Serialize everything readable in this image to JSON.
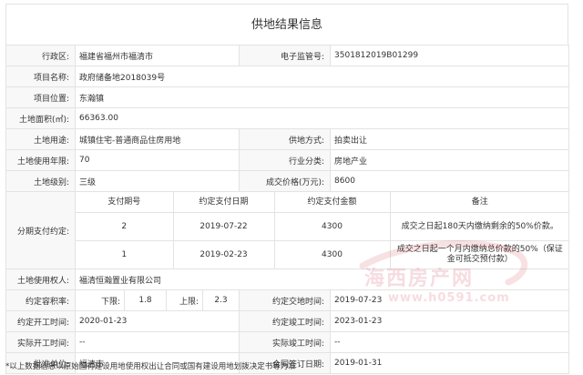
{
  "title": "供地结果信息",
  "fields": {
    "region": {
      "label": "行政区:",
      "value": "福建省福州市福清市"
    },
    "supervision_no": {
      "label": "电子监管号:",
      "value": "3501812019B01299"
    },
    "project_name": {
      "label": "项目名称:",
      "value": "政府储备地2018039号"
    },
    "project_location": {
      "label": "项目位置:",
      "value": "东瀚镇"
    },
    "land_area": {
      "label": "土地面积(㎡):",
      "value": "66363.00"
    },
    "land_use": {
      "label": "土地用途:",
      "value": "城镇住宅-普通商品住房用地"
    },
    "supply_method": {
      "label": "供地方式:",
      "value": "拍卖出让"
    },
    "use_years": {
      "label": "土地使用年限:",
      "value": "70"
    },
    "industry": {
      "label": "行业分类:",
      "value": "房地产业"
    },
    "land_grade": {
      "label": "土地级别:",
      "value": "三级"
    },
    "price": {
      "label": "成交价格(万元):",
      "value": "8600"
    },
    "installments": {
      "label": "分期支付约定:",
      "headers": [
        "支付期号",
        "约定支付日期",
        "约定支付金额",
        "备注"
      ],
      "rows": [
        {
          "period": "2",
          "date": "2019-07-22",
          "amount": "4300",
          "note": "成交之日起180天内缴纳剩余的50%价款。"
        },
        {
          "period": "1",
          "date": "2019-02-23",
          "amount": "4300",
          "note": "成交之日起一个月内缴纳总价款的50%（保证金可抵交预付款）"
        }
      ]
    },
    "land_user": {
      "label": "土地使用权人:",
      "value": "福清恒瀚置业有限公司"
    },
    "plot_ratio": {
      "label": "约定容积率:",
      "lower_label": "下限:",
      "lower": "1.8",
      "upper_label": "上限:",
      "upper": "2.3"
    },
    "delivery_date": {
      "label": "约定交地时间:",
      "value": "2019-07-23"
    },
    "start_date": {
      "label": "约定开工时间:",
      "value": "2020-01-23"
    },
    "completion_date": {
      "label": "约定竣工时间:",
      "value": "2023-01-23"
    },
    "actual_start": {
      "label": "实际开工时间:",
      "value": "--"
    },
    "actual_completion": {
      "label": "实际竣工时间:",
      "value": "--"
    },
    "approval_unit": {
      "label": "批准单位:",
      "value": "福清市"
    },
    "contract_date": {
      "label": "合同签订日期:",
      "value": "2019-01-31"
    }
  },
  "watermark": {
    "text": "海西房产网",
    "url": "www.h0591.com"
  },
  "footnote": "*以上数据信息以原始国有建设用地使用权出让合同或国有建设用地划拨决定书等为准"
}
